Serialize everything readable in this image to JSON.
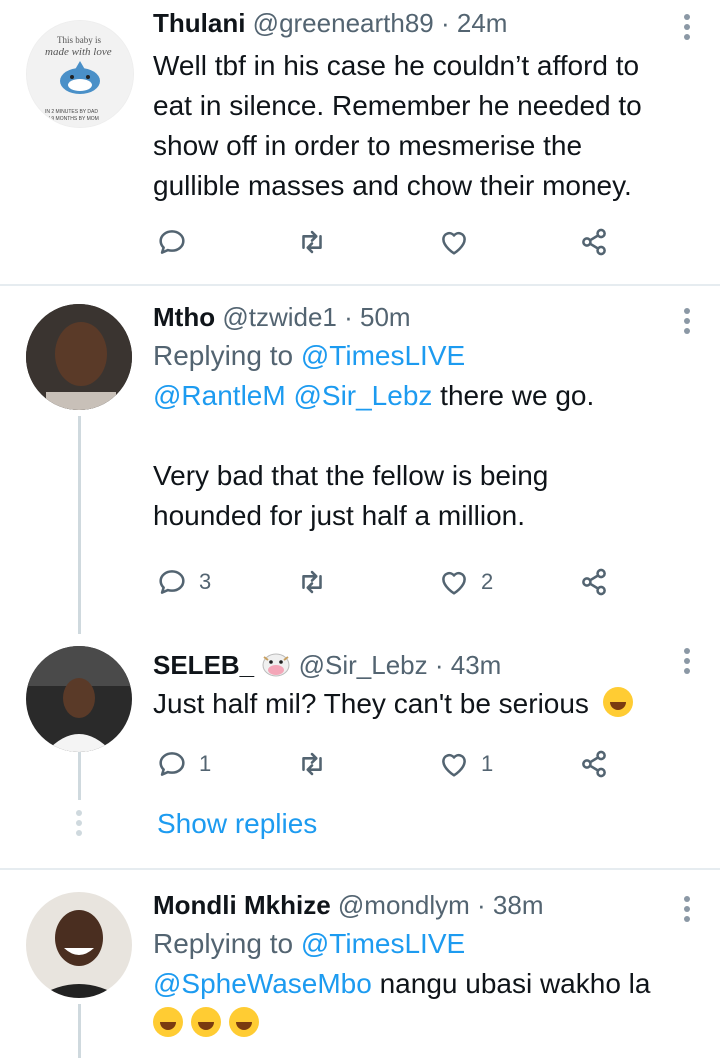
{
  "tweets": [
    {
      "name": "Thulani",
      "handle": "@greenearth89",
      "time": "· 24m",
      "lines": [
        "Well tbf in his case he couldn’t afford to",
        "eat in silence. Remember he needed to",
        "show off in order to mesmerise the",
        "gullible masses and chow their money."
      ],
      "avatar_text": [
        "This baby is",
        "made with love",
        "IN 2 MINUTES BY DAD",
        "IN 9 MONTHS BY MOM"
      ],
      "replies": "",
      "retweets": "",
      "likes": ""
    },
    {
      "name": "Mtho",
      "handle": "@tzwide1",
      "time": "· 50m",
      "replying_prefix": "Replying to",
      "replying_to": "@TimesLIVE",
      "mentions": "@RantleM @Sir_Lebz",
      "first_line_rest": " there we go.",
      "lines": [
        "Very bad that the fellow is being",
        "hounded for just half a million."
      ],
      "replies": "3",
      "retweets": "",
      "likes": "2"
    },
    {
      "name": "SELEB_",
      "handle": "@Sir_Lebz",
      "time": "· 43m",
      "name_emoji": "cow-face-emoji",
      "text": "Just half mil? They can't be serious",
      "text_emoji": "grinning-sweat-emoji",
      "replies": "1",
      "retweets": "",
      "likes": "1",
      "show_replies": "Show replies"
    },
    {
      "name": "Mondli Mkhize",
      "handle": "@mondlym",
      "time": "· 38m",
      "replying_prefix": "Replying to",
      "replying_to": "@TimesLIVE",
      "mentions": "@SpheWaseMbo",
      "first_line_rest": " nangu ubasi wakho la",
      "trailing_emoji": "rolling-on-floor-laughing-emoji",
      "trailing_emoji_count": 3
    }
  ],
  "colors": {
    "link": "#1d9bf0",
    "muted": "#536471",
    "text": "#0f1419",
    "divider": "#e6ecf0"
  }
}
